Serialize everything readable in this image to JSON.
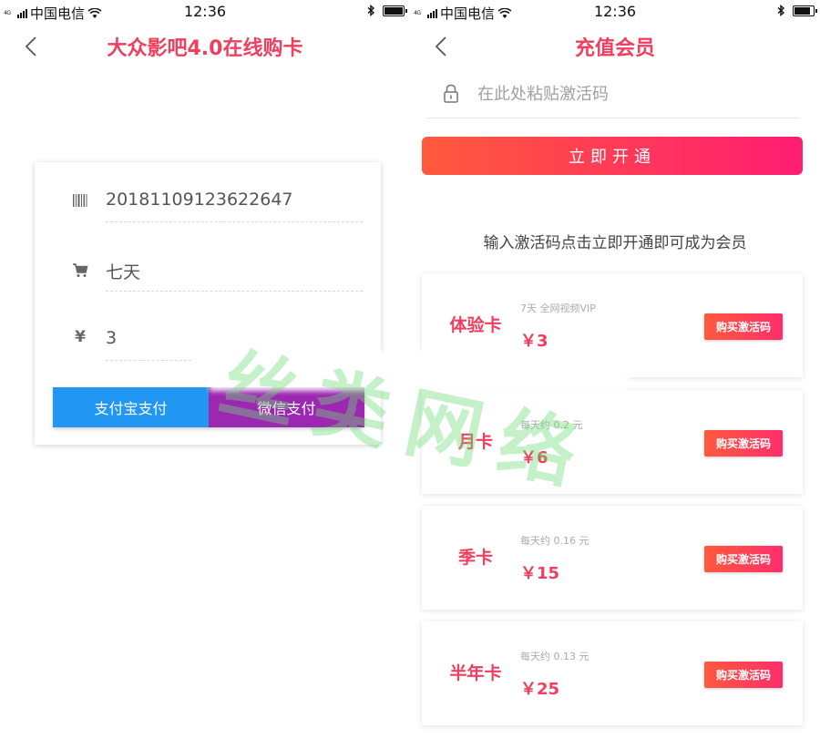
{
  "status_bar": {
    "network_tiny": "4G",
    "carrier": "中国电信",
    "time": "12:36"
  },
  "left_screen": {
    "title": "大众影吧4.0在线购卡",
    "order": {
      "order_number": "20181109123622647",
      "duration": "七天",
      "amount": "3",
      "currency_icon": "¥"
    },
    "buttons": {
      "alipay": "支付宝支付",
      "wechat": "微信支付"
    },
    "colors": {
      "alipay": "#2196f3",
      "wechat": "#9c27b0",
      "title": "#ef3e5e"
    }
  },
  "right_screen": {
    "title": "充值会员",
    "code_input": {
      "placeholder": "在此处粘贴激活码",
      "value": ""
    },
    "activate_label": "立即开通",
    "hint": "输入激活码点击立即开通即可成为会员",
    "plans": [
      {
        "name": "体验卡",
        "desc": "7天 全网视频VIP",
        "price": "￥3",
        "buy_label": "购买激活码"
      },
      {
        "name": "月卡",
        "desc": "每天约 0.2 元",
        "price": "￥6",
        "buy_label": "购买激活码"
      },
      {
        "name": "季卡",
        "desc": "每天约 0.16 元",
        "price": "￥15",
        "buy_label": "购买激活码"
      },
      {
        "name": "半年卡",
        "desc": "每天约 0.13 元",
        "price": "￥25",
        "buy_label": "购买激活码"
      }
    ],
    "colors": {
      "accent_start": "#ff5a3c",
      "accent_end": "#ff1d72"
    }
  },
  "watermark": "丝类网络"
}
